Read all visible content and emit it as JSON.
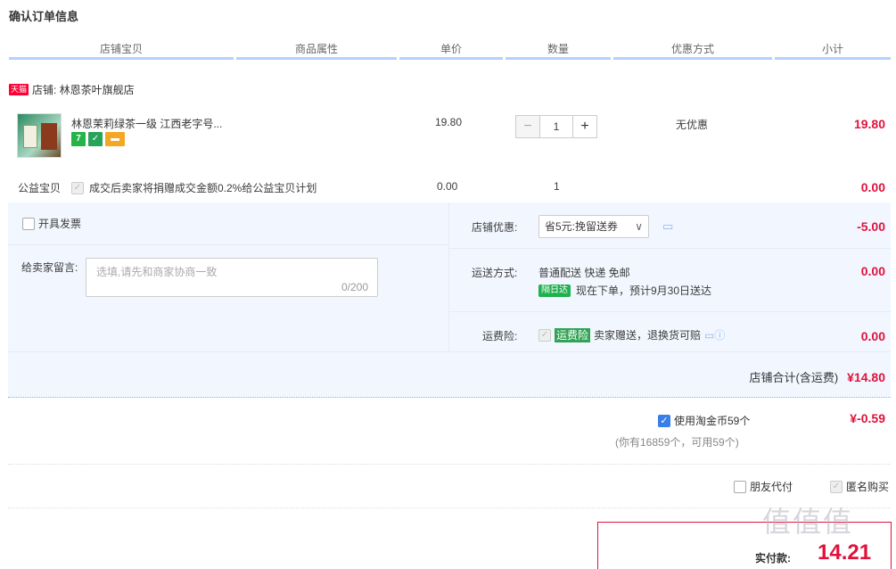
{
  "page_title": "确认订单信息",
  "columns": [
    "店铺宝贝",
    "商品属性",
    "单价",
    "数量",
    "优惠方式",
    "小计"
  ],
  "shop": {
    "badge": "天猫",
    "label": "店铺: 林恩茶叶旗舰店"
  },
  "item": {
    "name": "林恩茉莉绿茶一级 江西老字号...",
    "icons": [
      "seven-day-return-icon",
      "shield-icon",
      "card-icon"
    ],
    "seven_label": "7",
    "price": "19.80",
    "quantity": "1",
    "discount": "无优惠",
    "subtotal": "19.80"
  },
  "charity": {
    "label": "公益宝贝",
    "text": "成交后卖家将捐赠成交金额0.2%给公益宝贝计划",
    "price": "0.00",
    "quantity": "1",
    "subtotal": "0.00"
  },
  "invoice": {
    "label": "开具发票"
  },
  "message": {
    "label": "给卖家留言:",
    "placeholder": "选填,请先和商家协商一致",
    "counter": "0/200"
  },
  "shop_discount": {
    "label": "店铺优惠:",
    "selected": "省5元:挽留送券",
    "amount": "-5.00"
  },
  "shipping": {
    "label": "运送方式:",
    "method": "普通配送 快递 免邮",
    "tag": "隔日达",
    "eta": "现在下单，预计9月30日送达",
    "amount": "0.00"
  },
  "insurance": {
    "label": "运费险:",
    "tag": "运费险",
    "text": "卖家赠送，退换货可赔",
    "amount": "0.00"
  },
  "shop_total": {
    "label": "店铺合计(含运费)",
    "value": "¥14.80"
  },
  "coins": {
    "label": "使用淘金币59个",
    "note": "(你有16859个，可用59个)",
    "amount": "¥-0.59"
  },
  "options": {
    "friend_pay": "朋友代付",
    "anonymous": "匿名购买"
  },
  "final": {
    "label": "实付款:",
    "value": "14.21"
  },
  "watermark": "值值值",
  "colors": {
    "accent_red": "#e0123c",
    "header_line": "#b2d1ff",
    "panel_bg": "#f2f7ff"
  }
}
